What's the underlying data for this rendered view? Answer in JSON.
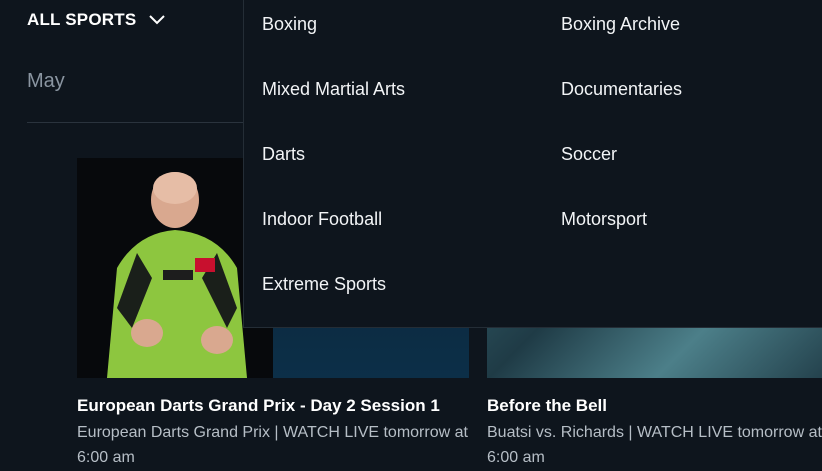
{
  "header": {
    "sports_label": "ALL SPORTS"
  },
  "month": "May",
  "dropdown": {
    "left_column": [
      "Boxing",
      "Mixed Martial Arts",
      "Darts",
      "Indoor Football",
      "Extreme Sports"
    ],
    "right_column": [
      "Boxing Archive",
      "Documentaries",
      "Soccer",
      "Motorsport"
    ]
  },
  "cards": [
    {
      "title": "European Darts Grand Prix - Day 2 Session 1",
      "subtitle": "European Darts Grand Prix | WATCH LIVE tomorrow at 6:00 am"
    },
    {
      "title": "Before the Bell",
      "subtitle": "Buatsi vs. Richards | WATCH LIVE tomorrow at 6:00 am"
    }
  ],
  "colors": {
    "background": "#0e151d",
    "accent_green": "#8dc63f"
  }
}
